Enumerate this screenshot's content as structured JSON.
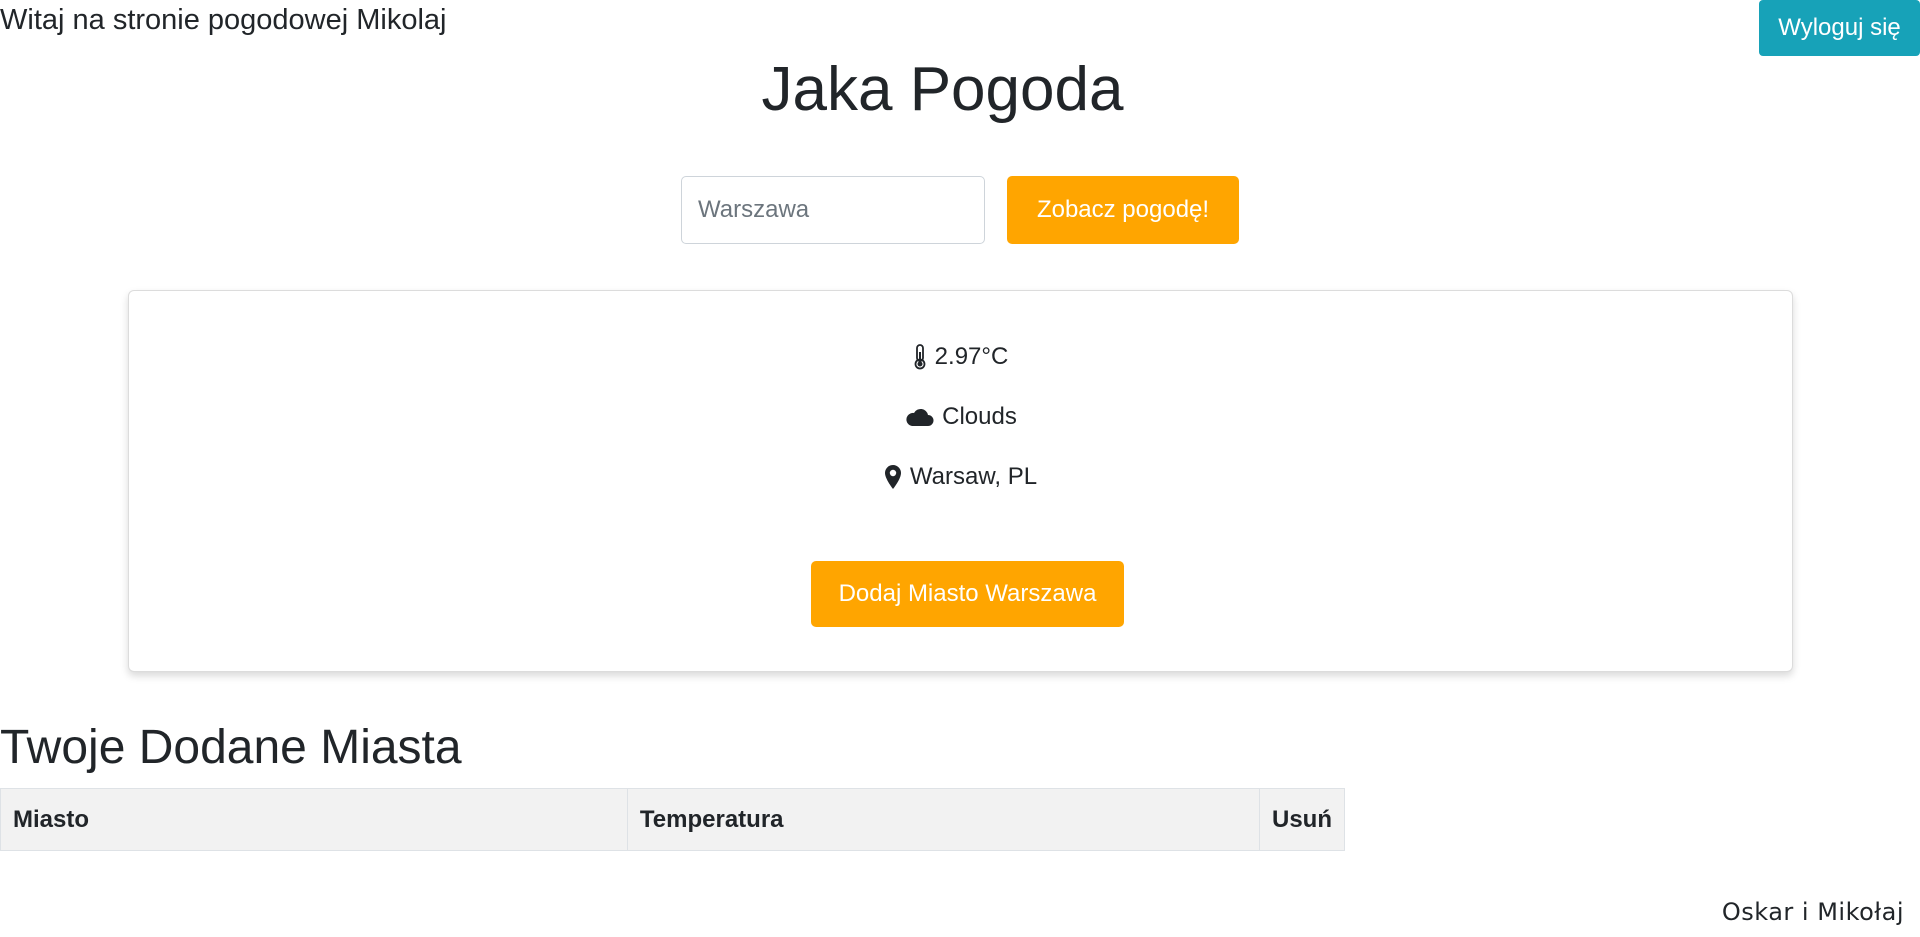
{
  "header": {
    "welcome_text": "Witaj na stronie pogodowej Mikolaj",
    "logout_label": "Wyloguj się"
  },
  "main": {
    "title": "Jaka Pogoda",
    "search": {
      "placeholder": "Warszawa",
      "value": "",
      "button_label": "Zobacz pogodę!"
    },
    "weather": {
      "temperature": "2.97°C",
      "condition": "Clouds",
      "location": "Warsaw, PL",
      "icons": [
        "thermometer-icon",
        "cloud-icon",
        "map-marker-icon"
      ],
      "add_button_label": "Dodaj Miasto Warszawa"
    }
  },
  "cities": {
    "heading": "Twoje Dodane Miasta",
    "columns": [
      "Miasto",
      "Temperatura",
      "Usuń"
    ],
    "rows": []
  },
  "footer": {
    "text": "Oskar i Mikołaj"
  },
  "colors": {
    "accent_orange": "#ffa500",
    "logout_teal": "#17a2b8",
    "text_dark": "#212529",
    "table_header_bg": "#f2f2f2"
  }
}
